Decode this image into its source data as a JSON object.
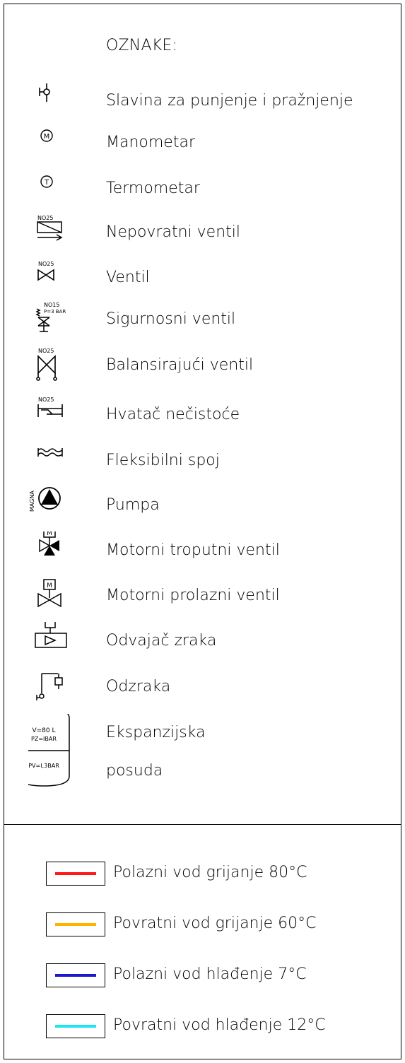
{
  "legend": {
    "title": "OZNAKE:",
    "items": [
      {
        "icon": "filling-draining-valve-icon",
        "label": "Slavina za punjenje i pražnjenje"
      },
      {
        "icon": "pressure-gauge-icon",
        "label": "Manometar",
        "symbol_text": "M"
      },
      {
        "icon": "thermometer-icon",
        "label": "Termometar",
        "symbol_text": "T"
      },
      {
        "icon": "check-valve-icon",
        "label": "Nepovratni ventil",
        "symbol_text": "NO25"
      },
      {
        "icon": "gate-valve-icon",
        "label": "Ventil",
        "symbol_text": "NO25"
      },
      {
        "icon": "safety-valve-icon",
        "label": "Sigurnosni ventil",
        "symbol_text": "NO15",
        "symbol_subtext": "P=3 BAR"
      },
      {
        "icon": "balancing-valve-icon",
        "label": "Balansirajući ventil",
        "symbol_text": "NO25"
      },
      {
        "icon": "strainer-icon",
        "label": "Hvatač nečistoće",
        "symbol_text": "NO25"
      },
      {
        "icon": "flexible-joint-icon",
        "label": "Fleksibilni spoj"
      },
      {
        "icon": "pump-icon",
        "label": "Pumpa",
        "symbol_text": "MAGNA"
      },
      {
        "icon": "motorized-three-way-valve-icon",
        "label": "Motorni troputni ventil",
        "symbol_text": "M"
      },
      {
        "icon": "motorized-two-way-valve-icon",
        "label": "Motorni prolazni ventil",
        "symbol_text": "M"
      },
      {
        "icon": "air-separator-icon",
        "label": "Odvajač zraka"
      },
      {
        "icon": "air-vent-icon",
        "label": "Odzraka"
      },
      {
        "icon": "expansion-vessel-icon",
        "label": "Ekspanzijska",
        "label_2": "posuda",
        "symbol_lines": [
          "V=80 L",
          "PZ=IBAR",
          "PV=I,3BAR"
        ]
      }
    ]
  },
  "pipes": [
    {
      "label": "Polazni vod grijanje 80°C",
      "color": "#ff1a1a"
    },
    {
      "label": "Povratni vod grijanje 60°C",
      "color": "#ffb300"
    },
    {
      "label": "Polazni vod hlađenje 7°C",
      "color": "#1a1acc"
    },
    {
      "label": "Povratni vod hlađenje 12°C",
      "color": "#19e6f0"
    }
  ]
}
